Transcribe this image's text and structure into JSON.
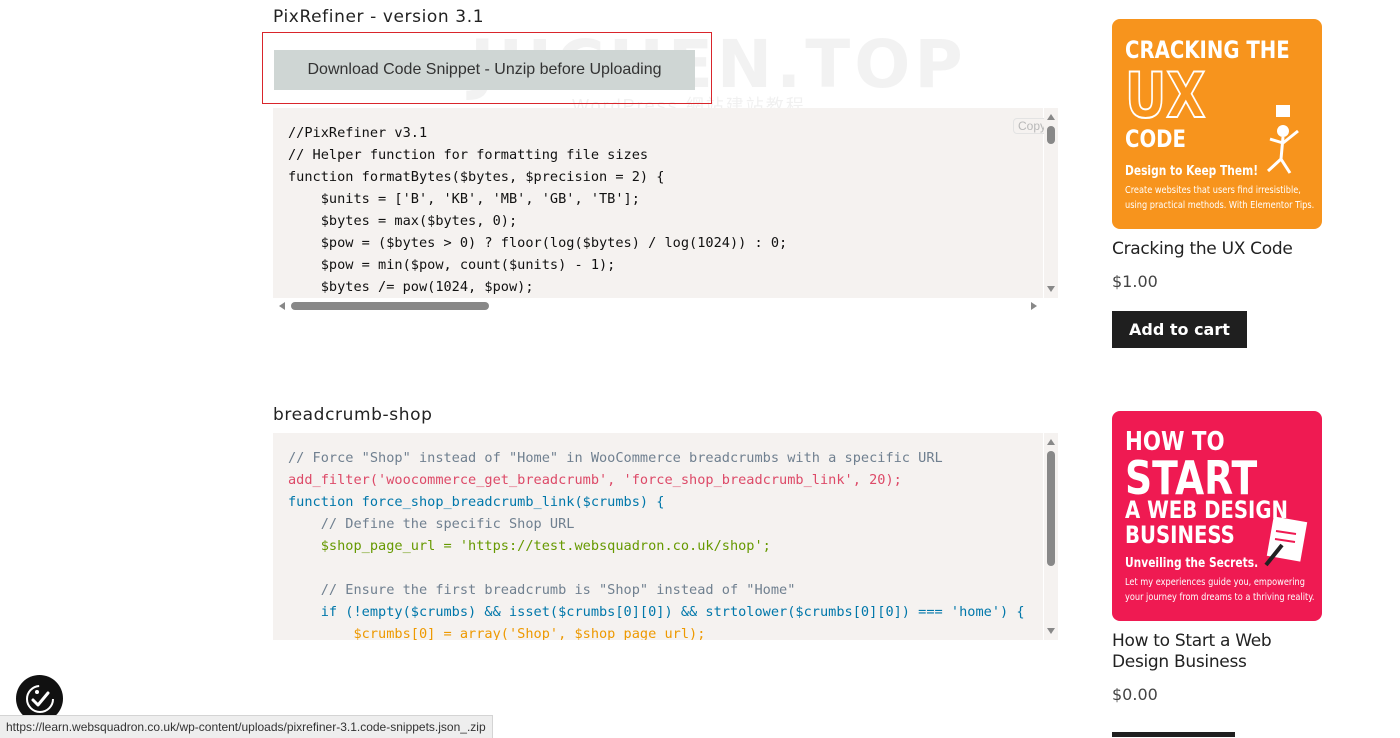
{
  "watermark": {
    "main": "JUCHEN.TOP",
    "sub": "WordPress 網站建站教程"
  },
  "section1": {
    "title": "PixRefiner - version 3.1",
    "download_label": "Download Code Snippet - Unzip before Uploading",
    "copy_label": "Copy",
    "code_lines": [
      "//PixRefiner v3.1",
      "// Helper function for formatting file sizes",
      "function formatBytes($bytes, $precision = 2) {",
      "    $units = ['B', 'KB', 'MB', 'GB', 'TB'];",
      "    $bytes = max($bytes, 0);",
      "    $pow = ($bytes > 0) ? floor(log($bytes) / log(1024)) : 0;",
      "    $pow = min($pow, count($units) - 1);",
      "    $bytes /= pow(1024, $pow);"
    ]
  },
  "section2": {
    "title": "breadcrumb-shop",
    "code_lines": [
      "// Force \"Shop\" instead of \"Home\" in WooCommerce breadcrumbs with a specific URL",
      "add_filter('woocommerce_get_breadcrumb', 'force_shop_breadcrumb_link', 20);",
      "function force_shop_breadcrumb_link($crumbs) {",
      "    // Define the specific Shop URL",
      "    $shop_page_url = 'https://test.websquadron.co.uk/shop';",
      "",
      "    // Ensure the first breadcrumb is \"Shop\" instead of \"Home\"",
      "    if (!empty($crumbs) && isset($crumbs[0][0]) && strtolower($crumbs[0][0]) === 'home') {",
      "        $crumbs[0] = array('Shop', $shop_page_url);"
    ]
  },
  "products": [
    {
      "cover": {
        "line1": "CRACKING THE",
        "line2": "UX",
        "line3": "CODE",
        "tagline": "Design to Keep Them!",
        "desc1": "Create websites that users find irresistible,",
        "desc2": "using practical methods. With Elementor Tips."
      },
      "name": "Cracking the UX Code",
      "price": "$1.00",
      "button": "Add to cart",
      "color": "#f7941d"
    },
    {
      "cover": {
        "line1": "HOW TO",
        "line2": "START",
        "line3": "A WEB DESIGN",
        "line4": "BUSINESS",
        "tagline": "Unveiling the Secrets.",
        "desc1": "Let my experiences guide you, empowering",
        "desc2": "your journey from dreams to a thriving reality."
      },
      "name_line1": "How to Start a Web",
      "name_line2": "Design Business",
      "price": "$0.00",
      "color": "#ef1a52"
    }
  ],
  "status_bar": {
    "url": "https://learn.websquadron.co.uk/wp-content/uploads/pixrefiner-3.1.code-snippets.json_.zip"
  },
  "icons": {
    "accessibility": "accessibility-icon"
  }
}
